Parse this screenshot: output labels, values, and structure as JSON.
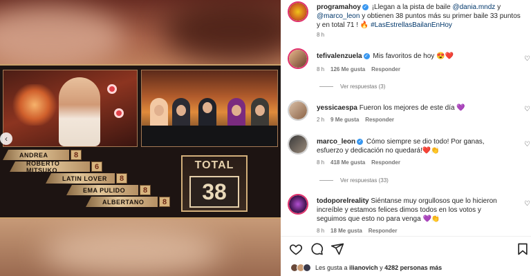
{
  "media": {
    "scores": [
      {
        "name": "ANDREA",
        "value": "8"
      },
      {
        "name": "ROBERTO MITSUKO",
        "value": "6"
      },
      {
        "name": "LATIN LOVER",
        "value": "8"
      },
      {
        "name": "EMA PULIDO",
        "value": "8"
      },
      {
        "name": "ALBERTANO",
        "value": "8"
      }
    ],
    "total_label": "TOTAL",
    "total_value": "38"
  },
  "post": {
    "author": "programahoy",
    "caption_pre": "¡Llegan a la pista de baile",
    "mention1": "@dania.mndz",
    "caption_y": "y",
    "mention2": "@marco_leon",
    "caption_mid": "y obtienen 38 puntos más su primer baile 33 puntos y en total 71 ! 🔥",
    "hashtag": "#LasEstrellasBailanEnHoy",
    "time": "8 h"
  },
  "comments": [
    {
      "user": "tefivalenzuela",
      "text": "Mis favoritos de hoy 😍❤️",
      "time": "8 h",
      "likes": "126 Me gusta",
      "reply": "Responder",
      "view_replies": "Ver respuestas (3)"
    },
    {
      "user": "yessicaespa",
      "text": "Fueron los mejores de este día 💜",
      "time": "2 h",
      "likes": "9 Me gusta",
      "reply": "Responder"
    },
    {
      "user": "marco_leon",
      "text": "Cómo siempre se dio todo! Por ganas, esfuerzo y dedicación no quedará!❤️👏",
      "time": "8 h",
      "likes": "418 Me gusta",
      "reply": "Responder",
      "view_replies": "Ver respuestas (33)"
    },
    {
      "user": "todoporelreality",
      "text": "Siéntanse muy orgullosos que lo hicieron increíble y estamos felices dimos todos en los votos y seguimos que esto no para venga 💜👏",
      "time": "8 h",
      "likes": "18 Me gusta",
      "reply": "Responder"
    }
  ],
  "likes_bar": {
    "prefix": "Les gusta a",
    "user": "ilianovich",
    "conj": "y",
    "count": "4282 personas más"
  },
  "icons": {
    "heart": "heart-icon",
    "comment": "comment-icon",
    "share": "share-icon",
    "save": "bookmark-icon",
    "verified": "verified-badge-icon",
    "carousel_prev": "chevron-left-icon"
  }
}
